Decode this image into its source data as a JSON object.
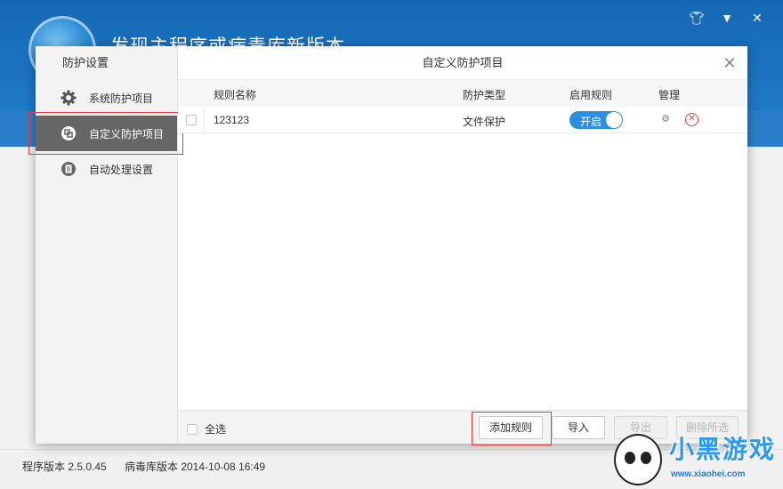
{
  "app": {
    "headline": "发现主程序或病毒库新版本",
    "footer": {
      "program_version": "程序版本 2.5.0.45",
      "virus_db_version": "病毒库版本 2014-10-08 16:49"
    },
    "top_icons": [
      "shirt-icon",
      "menu-icon",
      "close-icon"
    ]
  },
  "dialog": {
    "sidebar_title": "防护设置",
    "sidebar_items": [
      {
        "label": "系统防护项目",
        "icon": "gear-icon",
        "active": false
      },
      {
        "label": "自定义防护项目",
        "icon": "custom-rule-icon",
        "active": true
      },
      {
        "label": "自动处理设置",
        "icon": "auto-process-icon",
        "active": false
      }
    ],
    "title": "自定义防护项目",
    "table": {
      "headers": {
        "name": "规则名称",
        "type": "防护类型",
        "enabled": "启用规则",
        "manage": "管理"
      },
      "rows": [
        {
          "name": "123123",
          "type": "文件保护",
          "toggle_label": "开启",
          "enabled": true
        }
      ]
    },
    "footer": {
      "select_all": "全选",
      "add_rule": "添加规则",
      "import": "导入",
      "export": "导出",
      "delete_selected": "删除所选"
    }
  },
  "watermark": {
    "text": "小黑游戏",
    "url": "www.xiaohei.com"
  },
  "colors": {
    "accent": "#2a8fe0",
    "highlight_red": "#e03c3c",
    "active_sidebar": "#666666"
  }
}
